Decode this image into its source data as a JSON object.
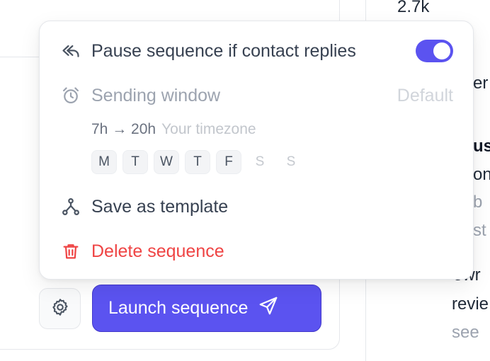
{
  "background": {
    "stat_value": "2.7k",
    "right_fragments": [
      "er",
      "ust",
      "on",
      "b",
      "st",
      "owr",
      "revie",
      "see"
    ]
  },
  "menu": {
    "pause_label": "Pause sequence if contact replies",
    "pause_enabled": true,
    "sending_window_label": "Sending window",
    "sending_window_value": "Default",
    "hours": "7h → 20h",
    "timezone": "Your timezone",
    "days": [
      {
        "label": "M",
        "active": true
      },
      {
        "label": "T",
        "active": true
      },
      {
        "label": "W",
        "active": true
      },
      {
        "label": "T",
        "active": true
      },
      {
        "label": "F",
        "active": true
      },
      {
        "label": "S",
        "active": false
      },
      {
        "label": "S",
        "active": false
      }
    ],
    "save_template_label": "Save as template",
    "delete_label": "Delete sequence"
  },
  "footer": {
    "launch_label": "Launch sequence"
  },
  "colors": {
    "accent": "#5b53f0",
    "danger": "#ef4444"
  }
}
